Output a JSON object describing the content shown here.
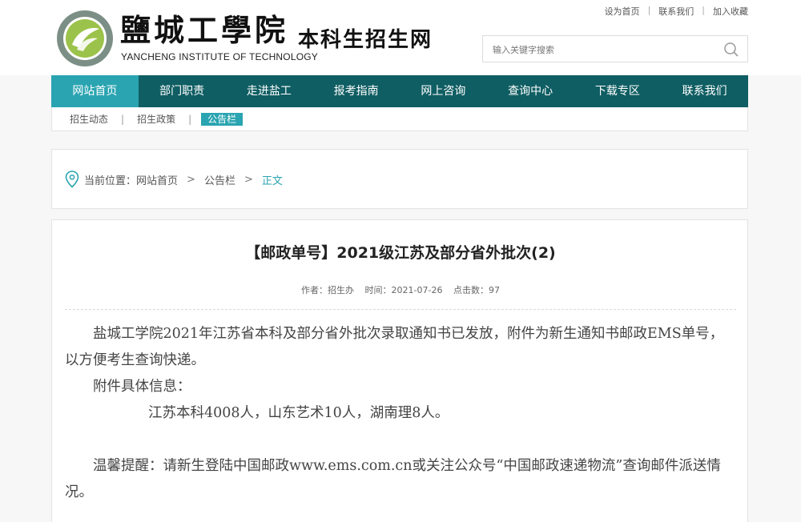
{
  "site": {
    "logo_cn": "鹽城工學院",
    "logo_en": "YANCHENG INSTITUTE OF TECHNOLOGY",
    "logo_sub": "本科生招生网"
  },
  "toplinks": [
    "设为首页",
    "联系我们",
    "加入收藏"
  ],
  "search": {
    "placeholder": "输入关键字搜索",
    "icon": "search-icon"
  },
  "nav": [
    "网站首页",
    "部门职责",
    "走进盐工",
    "报考指南",
    "网上咨询",
    "查询中心",
    "下载专区",
    "联系我们"
  ],
  "subnav": [
    "招生动态",
    "招生政策",
    "公告栏"
  ],
  "breadcrumb": {
    "prefix": "当前位置：",
    "items": [
      "网站首页",
      "公告栏",
      "正文"
    ],
    "sep": ">"
  },
  "article": {
    "title": "【邮政单号】2021级江苏及部分省外批次(2)",
    "author": "作者：招生办",
    "time": "时间：2021-07-26",
    "clicks": "点击数：97",
    "p1": "盐城工学院2021年江苏省本科及部分省外批次录取通知书已发放，附件为新生通知书邮政EMS单号，以方便考生查询快递。",
    "p2": "附件具体信息：",
    "p3": "江苏本科4008人，山东艺术10人，湖南理8人。",
    "p4": "温馨提醒：请新生登陆中国邮政www.ems.com.cn或关注公众号“中国邮政速递物流”查询邮件派送情况。"
  },
  "colors": {
    "nav_bg": "#0f5e63",
    "accent": "#2aa4b1"
  }
}
